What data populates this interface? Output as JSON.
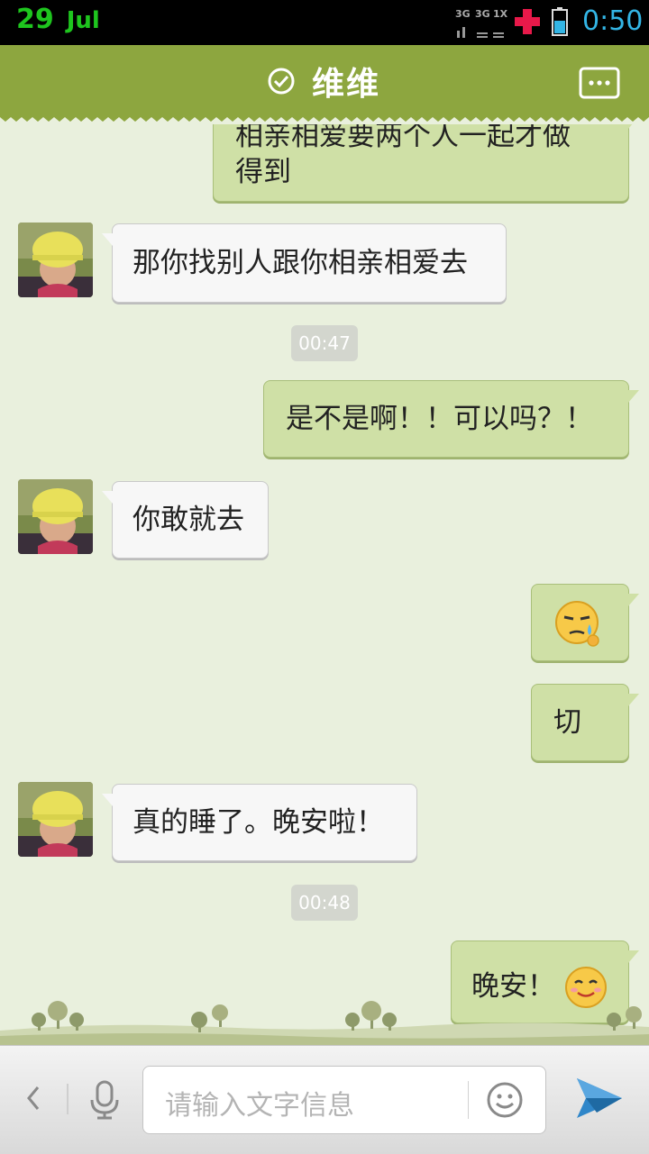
{
  "status_bar": {
    "day": "29",
    "month": "Jul",
    "network": [
      "3G",
      "3G",
      "1X"
    ],
    "time": "0:50"
  },
  "header": {
    "title": "维维"
  },
  "messages": [
    {
      "direction": "out",
      "lines": [
        "相亲相爱要两个人一起才做",
        "得到"
      ]
    },
    {
      "direction": "in",
      "text": "那你找别人跟你相亲相爱去"
    },
    {
      "timestamp": "00:47"
    },
    {
      "direction": "out",
      "text": "是不是啊！！可以吗？！"
    },
    {
      "direction": "in",
      "text": "你敢就去"
    },
    {
      "direction": "out",
      "emoji": "sweat-emoji"
    },
    {
      "direction": "out",
      "text": "切"
    },
    {
      "direction": "in",
      "text": "真的睡了。晚安啦！"
    },
    {
      "timestamp": "00:48"
    },
    {
      "direction": "out",
      "text": "晚安！",
      "emoji": "smile-emoji"
    }
  ],
  "input": {
    "placeholder": "请输入文字信息"
  },
  "colors": {
    "title_bar": "#8da63f",
    "outgoing_bubble": "#cfe0a6",
    "incoming_bubble": "#f7f7f7",
    "chat_background": "#e9f0dd",
    "clock": "#33b5e5",
    "date": "#1ec51e"
  }
}
